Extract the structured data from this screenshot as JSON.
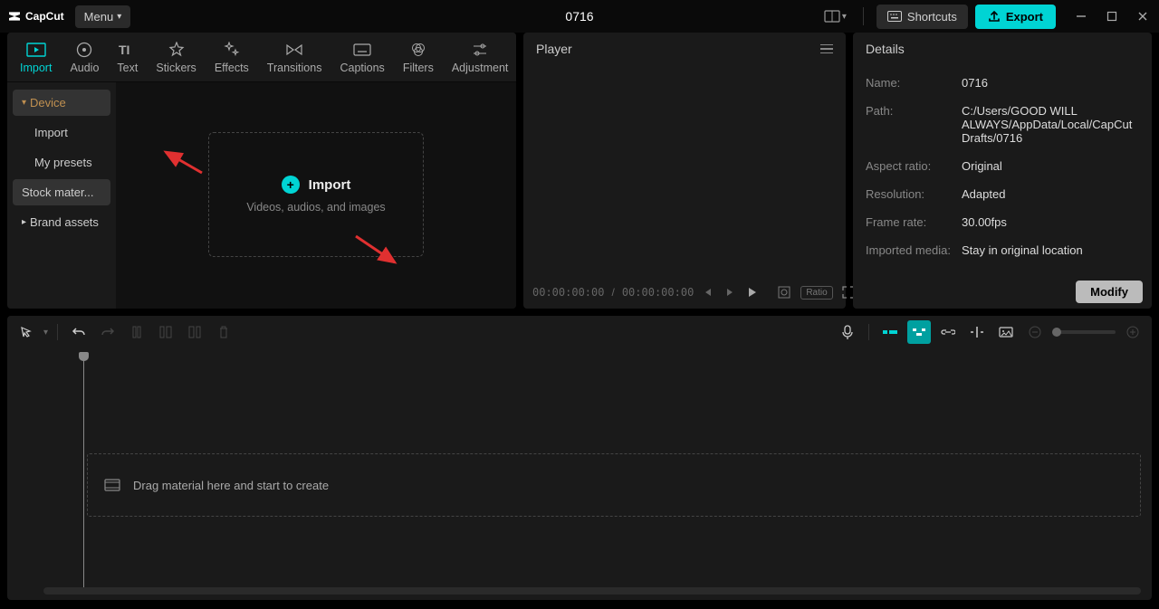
{
  "titlebar": {
    "app_name": "CapCut",
    "menu_label": "Menu",
    "project_title": "0716",
    "shortcuts_label": "Shortcuts",
    "export_label": "Export"
  },
  "media_tabs": [
    {
      "id": "import",
      "label": "Import"
    },
    {
      "id": "audio",
      "label": "Audio"
    },
    {
      "id": "text",
      "label": "Text"
    },
    {
      "id": "stickers",
      "label": "Stickers"
    },
    {
      "id": "effects",
      "label": "Effects"
    },
    {
      "id": "transitions",
      "label": "Transitions"
    },
    {
      "id": "captions",
      "label": "Captions"
    },
    {
      "id": "filters",
      "label": "Filters"
    },
    {
      "id": "adjustment",
      "label": "Adjustment"
    }
  ],
  "media_sidebar": {
    "device": "Device",
    "import": "Import",
    "presets": "My presets",
    "stock": "Stock mater...",
    "brand": "Brand assets"
  },
  "import_box": {
    "title": "Import",
    "subtitle": "Videos, audios, and images"
  },
  "player": {
    "title": "Player",
    "time_current": "00:00:00:00",
    "time_total": "00:00:00:00",
    "ratio_label": "Ratio"
  },
  "details": {
    "title": "Details",
    "rows": {
      "name": {
        "label": "Name:",
        "value": "0716"
      },
      "path": {
        "label": "Path:",
        "value": "C:/Users/GOOD WILL ALWAYS/AppData/Local/CapCut Drafts/0716"
      },
      "aspect": {
        "label": "Aspect ratio:",
        "value": "Original"
      },
      "resolution": {
        "label": "Resolution:",
        "value": "Adapted"
      },
      "framerate": {
        "label": "Frame rate:",
        "value": "30.00fps"
      },
      "imported": {
        "label": "Imported media:",
        "value": "Stay in original location"
      }
    },
    "modify_label": "Modify"
  },
  "timeline": {
    "drop_hint": "Drag material here and start to create"
  }
}
